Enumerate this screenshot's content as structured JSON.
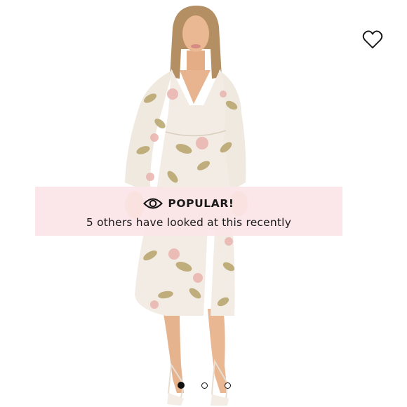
{
  "product": {
    "image_alt": "Model wearing a cream floral print long-sleeve midi wrap dress with a front slit",
    "colors": {
      "dress": "#f2ece4",
      "floral_green": "#b7a46a",
      "floral_pink": "#eab3ad",
      "skin": "#e9b792",
      "hair": "#b48f63"
    }
  },
  "wishlist": {
    "icon": "heart-outline-icon"
  },
  "popular_banner": {
    "icon": "eye-icon",
    "title": "POPULAR!",
    "message": "5 others have looked at this recently",
    "background": "#fbe5e7"
  },
  "carousel": {
    "dots": [
      {
        "active": true
      },
      {
        "active": false
      },
      {
        "active": false
      }
    ]
  }
}
